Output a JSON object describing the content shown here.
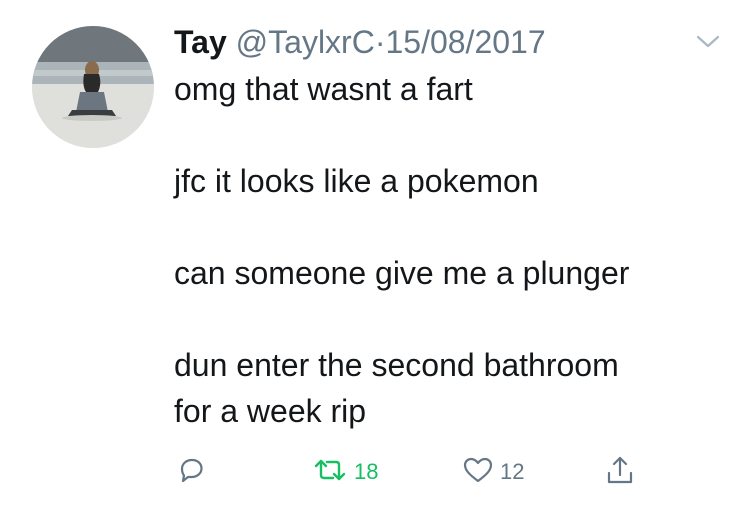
{
  "tweet": {
    "author_name": "Tay",
    "handle": "@TaylxrC",
    "separator": "·",
    "date": "15/08/2017",
    "lines": [
      "omg that wasnt a fart",
      "jfc it looks like a pokemon",
      "can someone give me a plunger",
      "dun enter the second bathroom\nfor a week rip"
    ],
    "retweet_count": "18",
    "like_count": "12"
  },
  "colors": {
    "text": "#14171a",
    "muted": "#657786",
    "retweet_green": "#17bf63"
  },
  "icons": {
    "reply": "reply-icon",
    "retweet": "retweet-icon",
    "like": "heart-icon",
    "share": "share-icon",
    "menu": "chevron-down-icon"
  }
}
